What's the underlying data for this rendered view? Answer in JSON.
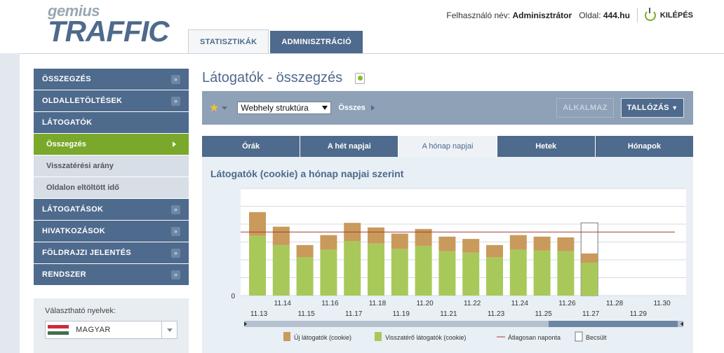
{
  "header": {
    "logo_top": "gemius",
    "logo_bottom": "TRAFFIC",
    "user_label": "Felhasználó név:",
    "user_name": "Adminisztrátor",
    "site_label": "Oldal:",
    "site_name": "444.hu",
    "logout": "KILÉPÉS",
    "tabs": [
      {
        "label": "STATISZTIKÁK",
        "active": true
      },
      {
        "label": "ADMINISZTRÁCIÓ",
        "active": false
      }
    ]
  },
  "sidebar": {
    "items": [
      {
        "label": "ÖSSZEGZÉS",
        "type": "section"
      },
      {
        "label": "OLDALLETÖLTÉSEK",
        "type": "section"
      },
      {
        "label": "LÁTOGATÓK",
        "type": "section-open"
      },
      {
        "label": "Összegzés",
        "type": "sub-active"
      },
      {
        "label": "Visszatérési arány",
        "type": "sub"
      },
      {
        "label": "Oldalon eltöltött idő",
        "type": "sub"
      },
      {
        "label": "LÁTOGATÁSOK",
        "type": "section"
      },
      {
        "label": "HIVATKOZÁSOK",
        "type": "section"
      },
      {
        "label": "FÖLDRAJZI JELENTÉS",
        "type": "section"
      },
      {
        "label": "RENDSZER",
        "type": "section"
      }
    ],
    "language_label": "Választható nyelvek:",
    "language_value": "MAGYAR"
  },
  "content": {
    "title": "Látogatók - összegzés",
    "toolbar": {
      "select_value": "Webhely struktúra",
      "breadcrumb": "Összes",
      "apply": "ALKALMAZ",
      "browse": "TALLÓZÁS"
    },
    "tabs": [
      {
        "label": "Órák",
        "active": false
      },
      {
        "label": "A hét napjai",
        "active": false
      },
      {
        "label": "A hónap napjai",
        "active": true
      },
      {
        "label": "Hetek",
        "active": false
      },
      {
        "label": "Hónapok",
        "active": false
      }
    ]
  },
  "colors": {
    "new_visitors": "#c99a5b",
    "returning_visitors": "#a8c95a",
    "average_line": "#a63a3a",
    "estimated": "#ffffff"
  },
  "chart_data": {
    "type": "bar",
    "title": "Látogatók (cookie) a hónap napjai szerint",
    "categories": [
      "11.13",
      "11.14",
      "11.15",
      "11.16",
      "11.17",
      "11.18",
      "11.19",
      "11.20",
      "11.21",
      "11.22",
      "11.23",
      "11.24",
      "11.25",
      "11.26",
      "11.27",
      "11.28",
      "11.29",
      "11.30"
    ],
    "series": [
      {
        "name": "Visszatérő látogatók (cookie)",
        "values": [
          78,
          66,
          50,
          60,
          71,
          68,
          61,
          65,
          58,
          56,
          50,
          60,
          59,
          58,
          43,
          0,
          0,
          0
        ]
      },
      {
        "name": "Új látogatók (cookie)",
        "values": [
          31,
          24,
          16,
          19,
          24,
          21,
          20,
          22,
          19,
          18,
          16,
          19,
          18,
          18,
          12,
          0,
          0,
          0
        ]
      }
    ],
    "estimated": [
      0,
      0,
      0,
      0,
      0,
      0,
      0,
      0,
      0,
      0,
      0,
      0,
      0,
      0,
      95,
      0,
      0,
      0
    ],
    "average_line": {
      "name": "Átlagosan naponta",
      "value": 83
    },
    "legend": [
      "Új látogatók (cookie)",
      "Visszatérő látogatók (cookie)",
      "Átlagosan naponta",
      "Becsült"
    ],
    "y_min_label": "0",
    "ylim": [
      0,
      140
    ],
    "grid": true,
    "legend_position": "bottom"
  }
}
